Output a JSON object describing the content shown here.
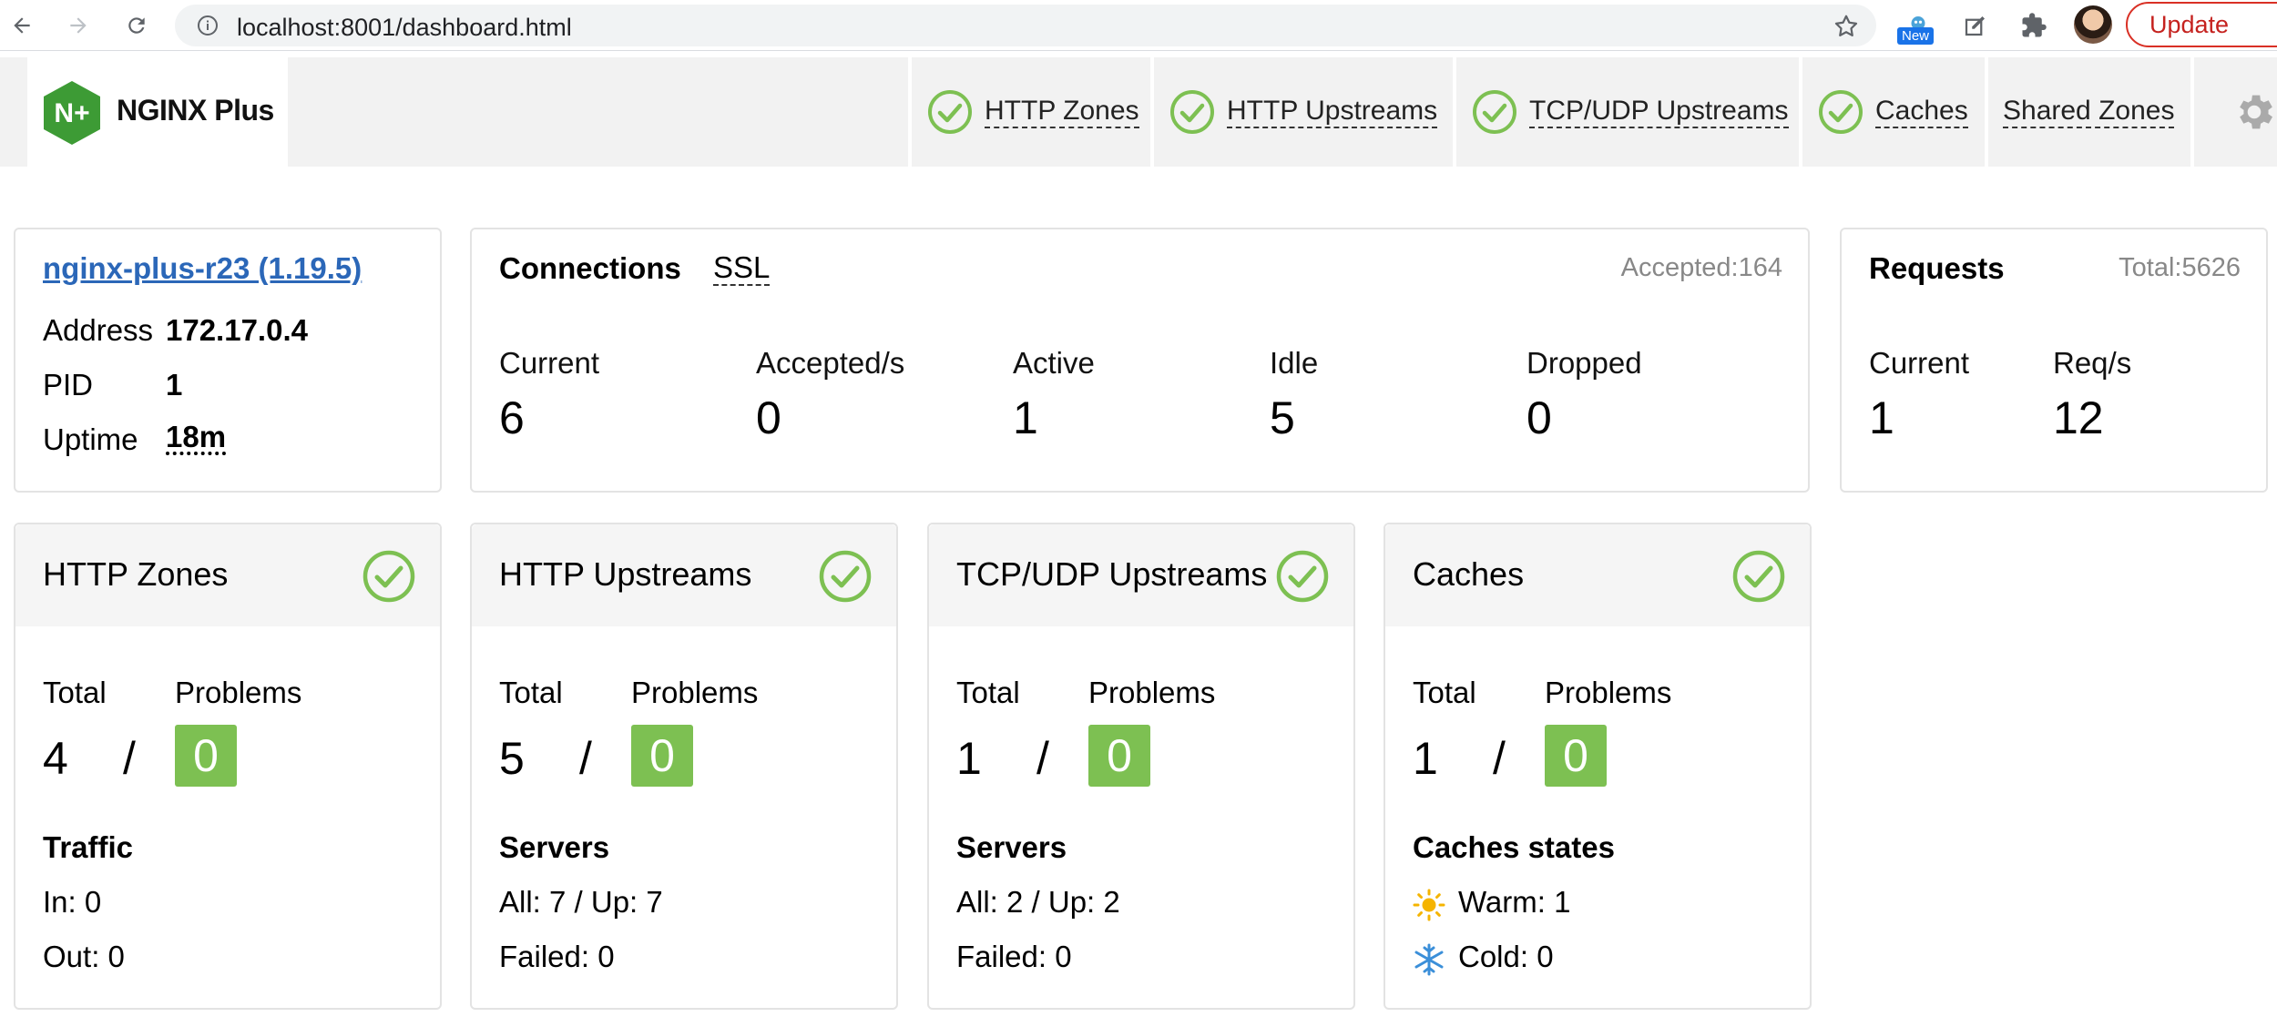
{
  "browser": {
    "url": "localhost:8001/dashboard.html",
    "new_badge": "New",
    "update_label": "Update"
  },
  "header": {
    "logo_text": "NGINX Plus",
    "logo_mark": "N+",
    "tabs": [
      {
        "label": "HTTP Zones",
        "status": "ok"
      },
      {
        "label": "HTTP Upstreams",
        "status": "ok"
      },
      {
        "label": "TCP/UDP Upstreams",
        "status": "ok"
      },
      {
        "label": "Caches",
        "status": "ok"
      },
      {
        "label": "Shared Zones",
        "status": "none"
      }
    ]
  },
  "info": {
    "title": "nginx-plus-r23 (1.19.5)",
    "address_label": "Address",
    "address": "172.17.0.4",
    "pid_label": "PID",
    "pid": "1",
    "uptime_label": "Uptime",
    "uptime": "18m"
  },
  "connections": {
    "title": "Connections",
    "ssl_tab": "SSL",
    "accepted": "Accepted:164",
    "stats": [
      {
        "label": "Current",
        "value": "6"
      },
      {
        "label": "Accepted/s",
        "value": "0"
      },
      {
        "label": "Active",
        "value": "1"
      },
      {
        "label": "Idle",
        "value": "5"
      },
      {
        "label": "Dropped",
        "value": "0"
      }
    ]
  },
  "requests": {
    "title": "Requests",
    "total": "Total:5626",
    "stats": [
      {
        "label": "Current",
        "value": "1"
      },
      {
        "label": "Req/s",
        "value": "12"
      }
    ]
  },
  "status_cards": [
    {
      "title": "HTTP Zones",
      "total_label": "Total",
      "total": "4",
      "slash": "/",
      "problems_label": "Problems",
      "problems": "0",
      "sub_title": "Traffic",
      "line1": "In: 0",
      "line2": "Out: 0"
    },
    {
      "title": "HTTP Upstreams",
      "total_label": "Total",
      "total": "5",
      "slash": "/",
      "problems_label": "Problems",
      "problems": "0",
      "sub_title": "Servers",
      "line1": "All: 7 / Up: 7",
      "line2": "Failed: 0"
    },
    {
      "title": "TCP/UDP Upstreams",
      "total_label": "Total",
      "total": "1",
      "slash": "/",
      "problems_label": "Problems",
      "problems": "0",
      "sub_title": "Servers",
      "line1": "All: 2 / Up: 2",
      "line2": "Failed: 0"
    },
    {
      "title": "Caches",
      "total_label": "Total",
      "total": "1",
      "slash": "/",
      "problems_label": "Problems",
      "problems": "0",
      "sub_title": "Caches states",
      "line1": "Warm: 1",
      "line2": "Cold: 0",
      "line1_icon": "sun-icon",
      "line2_icon": "snowflake-icon"
    }
  ],
  "colors": {
    "ok_green": "#7dc052",
    "logo_green": "#3d9b35",
    "link_blue": "#2b67b8",
    "header_bg": "#f2f2f2"
  }
}
